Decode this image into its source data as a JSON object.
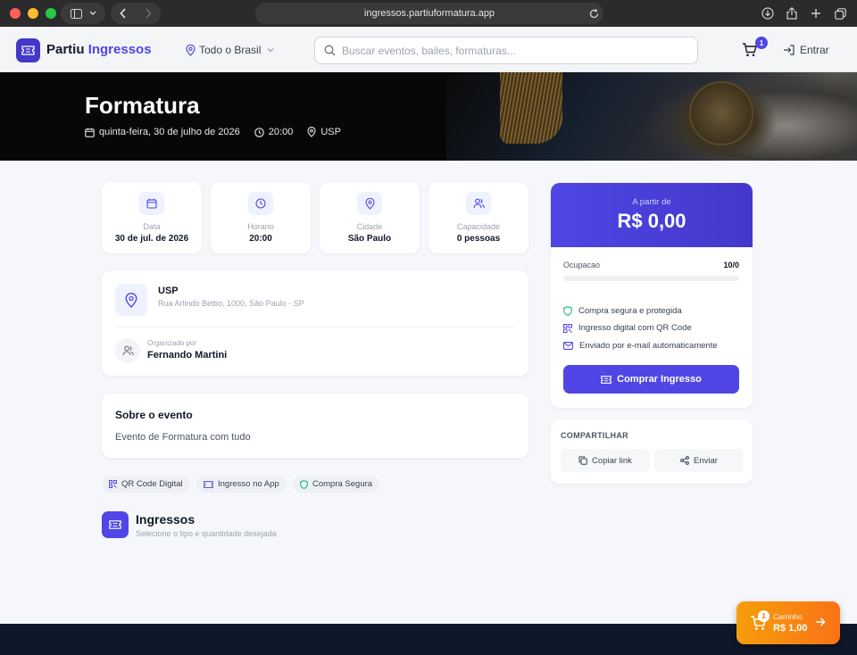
{
  "browser": {
    "url": "ingressos.partiuformatura.app"
  },
  "header": {
    "brand_primary": "Partiu",
    "brand_accent": "Ingressos",
    "location": "Todo o Brasil",
    "search_placeholder": "Buscar eventos, bailes, formaturas...",
    "cart_count": "1",
    "login_label": "Entrar"
  },
  "event": {
    "title": "Formatura",
    "date_long": "quinta-feira, 30 de julho de 2026",
    "time": "20:00",
    "venue_short": "USP"
  },
  "stats": [
    {
      "label": "Data",
      "value": "30 de jul. de 2026",
      "icon": "calendar-icon"
    },
    {
      "label": "Horario",
      "value": "20:00",
      "icon": "clock-icon"
    },
    {
      "label": "Cidade",
      "value": "São Paulo",
      "icon": "map-pin-icon"
    },
    {
      "label": "Capacidade",
      "value": "0 pessoas",
      "icon": "users-icon"
    }
  ],
  "venue": {
    "name": "USP",
    "address": "Rua Arlindo Bettio, 1000, São Paulo - SP"
  },
  "organizer": {
    "label": "Organizado por",
    "name": "Fernando Martini"
  },
  "about": {
    "title": "Sobre o evento",
    "text": "Evento de Formatura com tudo"
  },
  "chips": [
    "QR Code Digital",
    "Ingresso no App",
    "Compra Segura"
  ],
  "tickets": {
    "title": "Ingressos",
    "subtitle": "Selecione o tipo e quantidade desejada"
  },
  "pricing": {
    "from_label": "A partir de",
    "price": "R$ 0,00",
    "occupancy_label": "Ocupacao",
    "occupancy_value": "10/0",
    "occupancy_fill_percent": 0,
    "features": [
      "Compra segura e protegida",
      "Ingresso digital com QR Code",
      "Enviado por e-mail automaticamente"
    ],
    "buy_label": "Comprar Ingresso"
  },
  "share": {
    "title": "COMPARTILHAR",
    "copy_label": "Copiar link",
    "send_label": "Enviar"
  },
  "floating_cart": {
    "count": "1",
    "label": "Carrinho",
    "total": "R$ 1,00"
  },
  "colors": {
    "accent": "#4f46e5",
    "cart_orange": "#f59e0b",
    "secure_green": "#10b981"
  }
}
